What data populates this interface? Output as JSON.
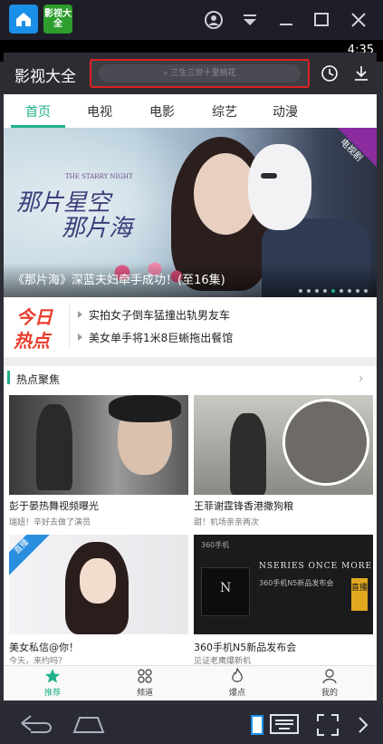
{
  "status_bar": {
    "time": "4:35"
  },
  "header": {
    "app_title": "影视大全",
    "search_placeholder": "三生三世十里桃花",
    "history_icon": "clock-icon",
    "download_icon": "download-icon"
  },
  "tabs": [
    {
      "label": "首页",
      "active": true
    },
    {
      "label": "电视",
      "active": false
    },
    {
      "label": "电影",
      "active": false
    },
    {
      "label": "综艺",
      "active": false
    },
    {
      "label": "动漫",
      "active": false
    }
  ],
  "banner": {
    "title_en_a": "THE STARRY NIGHT",
    "title_cn_a": "那片星空",
    "title_cn_b": "那片海",
    "badge": "电视剧",
    "caption": "《那片海》深蓝夫妇牵手成功！(至16集)"
  },
  "hot_news": {
    "logo_line1": "今日",
    "logo_line2": "热点",
    "items": [
      "实拍女子倒车猛撞出轨男友车",
      "美女单手将1米8巨蜥拖出餐馆"
    ]
  },
  "section": {
    "title": "热点聚焦"
  },
  "cards": [
    {
      "title": "彭于晏热舞视频曝光",
      "subtitle": "瑞妞！辛好去做了演员",
      "badge": ""
    },
    {
      "title": "王菲谢霆锋香港撒狗粮",
      "subtitle": "甜！机场亲亲两次",
      "badge": ""
    },
    {
      "title": "美女私信@你！",
      "subtitle": "今天，来约吗？",
      "badge": "直播"
    },
    {
      "title": "360手机N5新品发布会",
      "subtitle": "见证老鹰爆新机",
      "badge": "直播",
      "poster_text": "NSERIES ONCE MORE",
      "poster_sub": "360手机N5新品发布会",
      "poster_brand": "360手机"
    }
  ],
  "bottom_nav": [
    {
      "label": "推荐",
      "icon": "star-icon"
    },
    {
      "label": "频道",
      "icon": "grid-icon"
    },
    {
      "label": "爆点",
      "icon": "flame-icon"
    },
    {
      "label": "我的",
      "icon": "user-icon"
    }
  ],
  "window": {
    "app2_label": "影视大全",
    "controls": [
      "account-icon",
      "dropdown-icon",
      "minimize-icon",
      "maximize-icon",
      "close-icon"
    ]
  }
}
